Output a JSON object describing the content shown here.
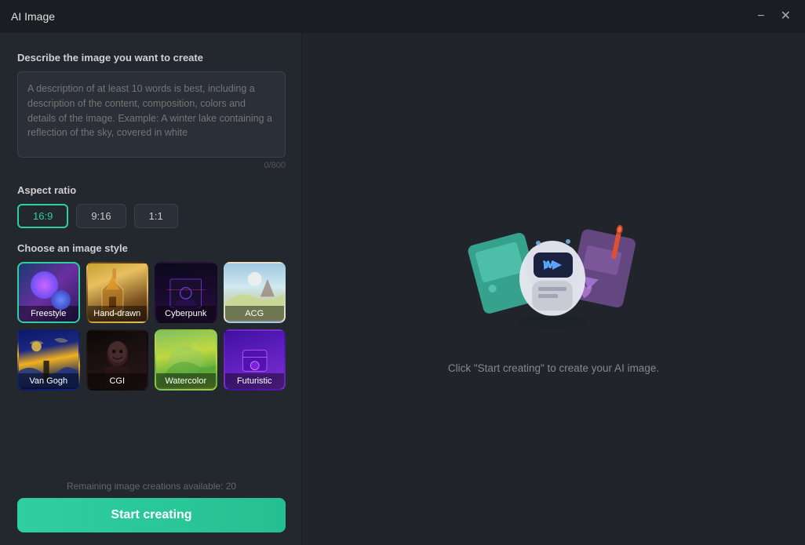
{
  "window": {
    "title": "AI Image",
    "minimize_label": "−",
    "close_label": "✕"
  },
  "left": {
    "prompt_section_label": "Describe the image you want to create",
    "prompt_placeholder": "A description of at least 10 words is best, including a description of the content, composition, colors and details of the image. Example: A winter lake containing a reflection of the sky, covered in white",
    "char_count": "0/800",
    "aspect_ratio_label": "Aspect ratio",
    "aspect_options": [
      {
        "label": "16:9",
        "active": true
      },
      {
        "label": "9:16",
        "active": false
      },
      {
        "label": "1:1",
        "active": false
      }
    ],
    "style_section_label": "Choose an image style",
    "styles": [
      {
        "id": "freestyle",
        "label": "Freestyle",
        "selected": true,
        "css_class": "style-freestyle"
      },
      {
        "id": "handdrawn",
        "label": "Hand-drawn",
        "selected": false,
        "css_class": "style-handdrawn"
      },
      {
        "id": "cyberpunk",
        "label": "Cyberpunk",
        "selected": false,
        "css_class": "style-cyberpunk"
      },
      {
        "id": "acg",
        "label": "ACG",
        "selected": false,
        "css_class": "style-acg"
      },
      {
        "id": "vangogh",
        "label": "Van Gogh",
        "selected": false,
        "css_class": "style-vangogh"
      },
      {
        "id": "cgi",
        "label": "CGI",
        "selected": false,
        "css_class": "style-cgi"
      },
      {
        "id": "watercolor",
        "label": "Watercolor",
        "selected": false,
        "css_class": "style-watercolor"
      },
      {
        "id": "futuristic",
        "label": "Futuristic",
        "selected": false,
        "css_class": "style-futuristic"
      }
    ],
    "remaining_text": "Remaining image creations available: 20",
    "start_btn_label": "Start creating"
  },
  "right": {
    "instruction": "Click \"Start creating\" to create your AI image."
  }
}
